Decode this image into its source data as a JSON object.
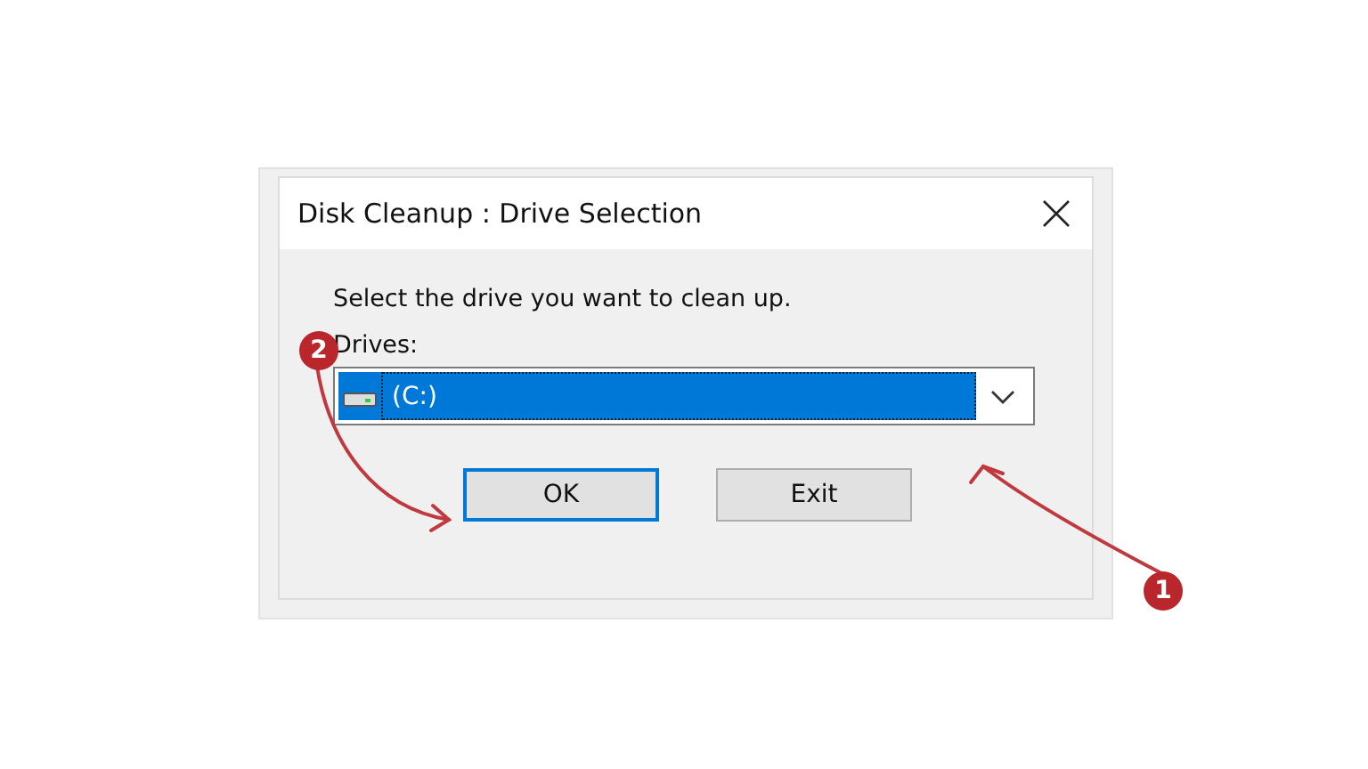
{
  "window": {
    "title": "Disk Cleanup : Drive Selection"
  },
  "prompt": "Select the drive you want to clean up.",
  "drives": {
    "label": "Drives:",
    "value": {
      "label": "(C:)",
      "selected": true
    }
  },
  "buttons": [
    {
      "label": "OK",
      "focused": true
    },
    {
      "label": "Exit",
      "focused": false
    }
  ],
  "annotations": [
    {
      "number": "1"
    },
    {
      "number": "2"
    }
  ]
}
